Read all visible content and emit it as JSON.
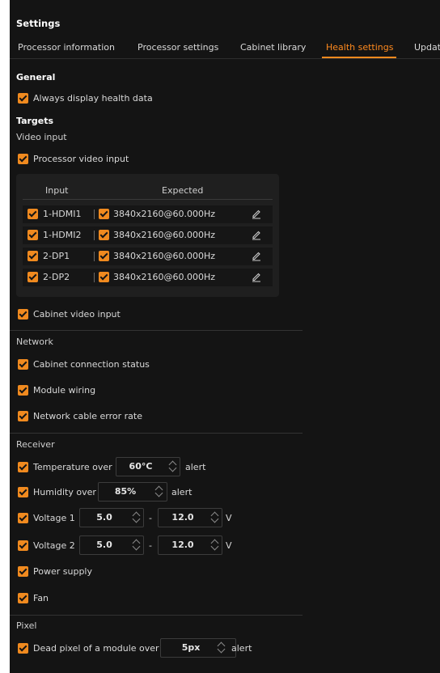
{
  "title": "Settings",
  "tabs": [
    "Processor information",
    "Processor settings",
    "Cabinet library",
    "Health settings",
    "Updat"
  ],
  "general": {
    "heading": "General",
    "always_display": "Always display health data"
  },
  "targets": {
    "heading": "Targets",
    "video_input": "Video input",
    "processor_video_input": "Processor video input",
    "table": {
      "col_input": "Input",
      "col_expected": "Expected",
      "rows": [
        {
          "input": "1-HDMI1",
          "expected": "3840x2160@60.000Hz"
        },
        {
          "input": "1-HDMI2",
          "expected": "3840x2160@60.000Hz"
        },
        {
          "input": "2-DP1",
          "expected": "3840x2160@60.000Hz"
        },
        {
          "input": "2-DP2",
          "expected": "3840x2160@60.000Hz"
        }
      ]
    },
    "cabinet_video_input": "Cabinet video input"
  },
  "network": {
    "heading": "Network",
    "connection_status": "Cabinet connection status",
    "module_wiring": "Module wiring",
    "cable_error": "Network cable error rate"
  },
  "receiver": {
    "heading": "Receiver",
    "temp_label": "Temperature over",
    "temp_value": "60°C",
    "alert": "alert",
    "humidity_label": "Humidity over",
    "humidity_value": "85%",
    "voltage1_label": "Voltage 1",
    "voltage1_min": "5.0",
    "voltage1_max": "12.0",
    "voltage2_label": "Voltage 2",
    "voltage2_min": "5.0",
    "voltage2_max": "12.0",
    "dash": "-",
    "unit_v": "V",
    "power_supply": "Power supply",
    "fan": "Fan"
  },
  "pixel": {
    "heading": "Pixel",
    "dead_pixel_label": "Dead pixel of a module over",
    "dead_pixel_value": "5px",
    "alert": "alert"
  },
  "colors": {
    "accent": "#f08a1f",
    "background": "#141414"
  },
  "icons": {
    "checkbox": "check-icon",
    "edit": "pencil-icon",
    "spinner": "chevron-up-down-icon"
  }
}
